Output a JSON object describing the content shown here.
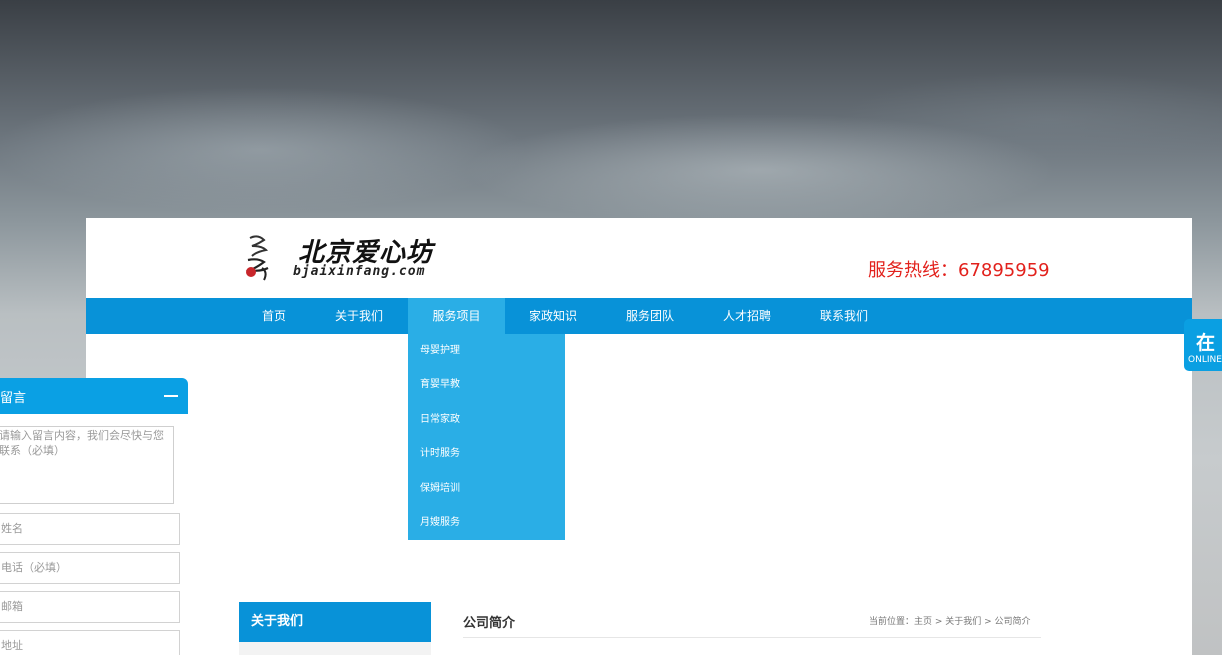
{
  "header": {
    "logo_title": "北京爱心坊",
    "logo_domain": "bjaixinfang.com",
    "hotline": "服务热线：67895959"
  },
  "nav": {
    "items": [
      {
        "label": "首页"
      },
      {
        "label": "关于我们"
      },
      {
        "label": "服务项目"
      },
      {
        "label": "家政知识"
      },
      {
        "label": "服务团队"
      },
      {
        "label": "人才招聘"
      },
      {
        "label": "联系我们"
      }
    ],
    "active_index": 2
  },
  "dropdown": {
    "items": [
      {
        "label": "母婴护理"
      },
      {
        "label": "育婴早教"
      },
      {
        "label": "日常家政"
      },
      {
        "label": "计时服务"
      },
      {
        "label": "保姆培训"
      },
      {
        "label": "月嫂服务"
      }
    ]
  },
  "content": {
    "sidebar_title": "关于我们",
    "section_title": "公司简介",
    "breadcrumb": "当前位置：主页 > 关于我们 > 公司简介"
  },
  "message_widget": {
    "title": "留言",
    "textarea_placeholder": "请输入留言内容，我们会尽快与您联系（必填）",
    "name_placeholder": "姓名",
    "phone_placeholder": "电话（必填）",
    "email_placeholder": "邮箱",
    "address_placeholder": "地址"
  },
  "online_tab": {
    "char": "在",
    "label": "ONLINE"
  },
  "colors": {
    "nav_blue": "#0892d8",
    "nav_active": "#2aaee6",
    "hotline_red": "#e2211c",
    "widget_blue": "#0aa0e4"
  }
}
